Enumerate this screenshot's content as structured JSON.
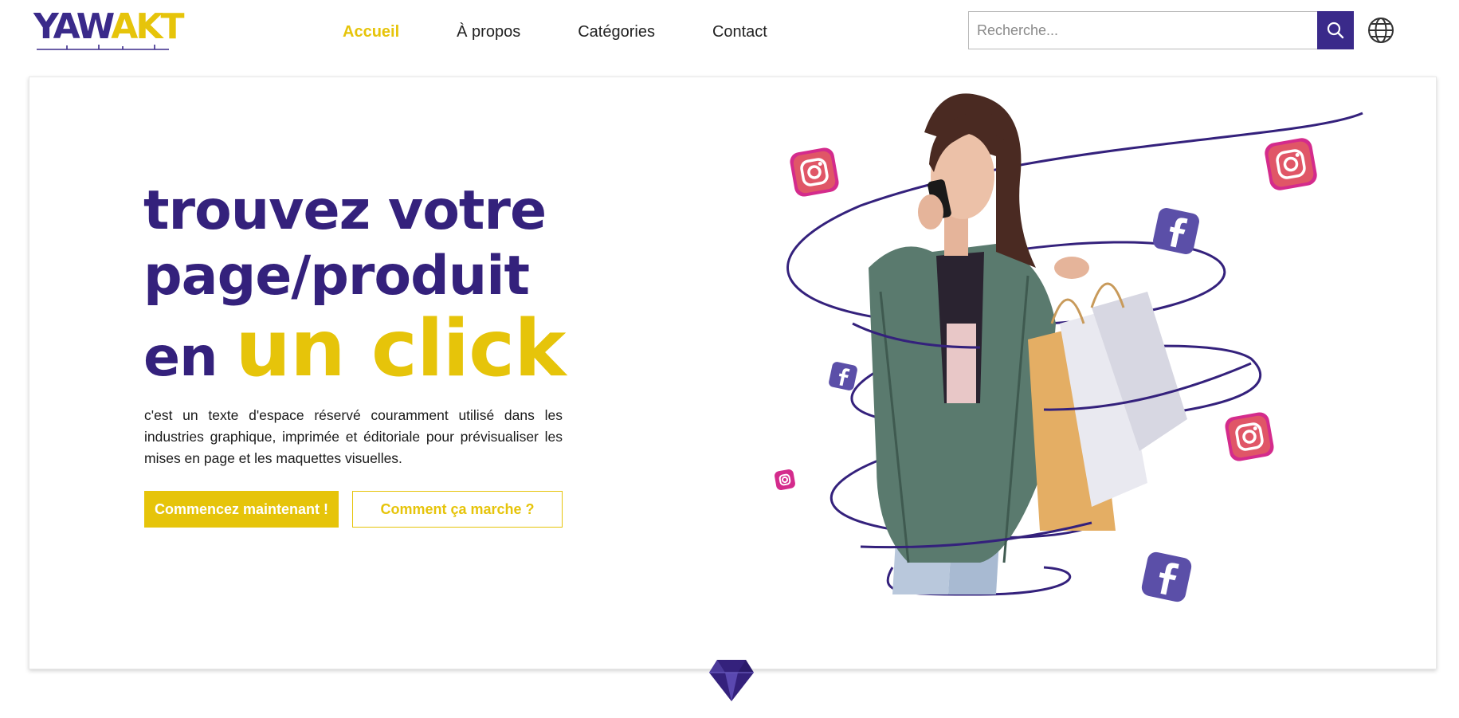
{
  "brand": {
    "logo_main_a": "YAW",
    "logo_main_b": "AKT",
    "logo_name": "YAWAKT"
  },
  "nav": [
    {
      "label": "Accueil",
      "active": true
    },
    {
      "label": "À propos",
      "active": false
    },
    {
      "label": "Catégories",
      "active": false
    },
    {
      "label": "Contact",
      "active": false
    }
  ],
  "search": {
    "placeholder": "Recherche...",
    "value": "",
    "icon": "search-icon"
  },
  "language": {
    "icon": "globe-icon"
  },
  "hero": {
    "headline_line1": "trouvez votre",
    "headline_line2": "page/produit",
    "headline_line3_prefix": "en ",
    "headline_line3_accent": "un click",
    "description": "c'est un texte d'espace réservé couramment utilisé dans les industries graphique, imprimée et éditoriale pour prévisualiser les mises en page et les maquettes visuelles.",
    "primary_button": "Commencez maintenant !",
    "secondary_button": "Comment ça marche ?"
  },
  "colors": {
    "primary_purple": "#34217c",
    "accent_yellow": "#e6c40a",
    "search_button": "#3a2a8a"
  },
  "decor": {
    "scroll_icon": "diamond-icon"
  }
}
